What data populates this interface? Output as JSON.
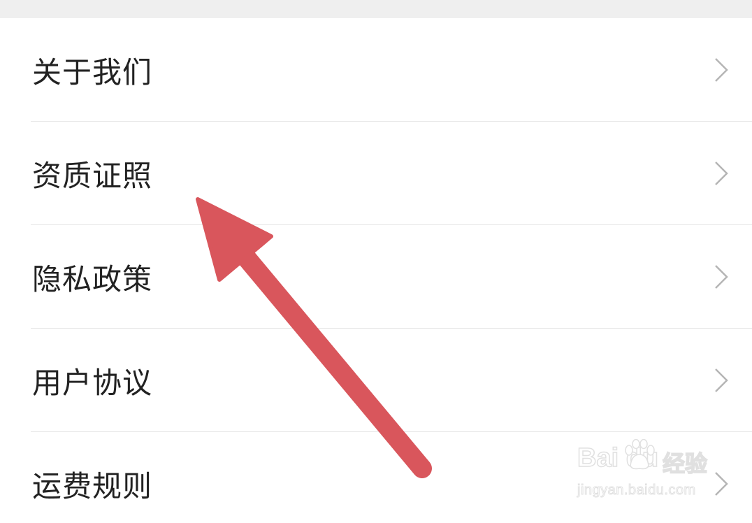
{
  "menu": {
    "items": [
      {
        "label": "关于我们",
        "chevron": "chevron-right-icon"
      },
      {
        "label": "资质证照",
        "chevron": "chevron-right-icon"
      },
      {
        "label": "隐私政策",
        "chevron": "chevron-right-icon"
      },
      {
        "label": "用户协议",
        "chevron": "chevron-right-icon"
      },
      {
        "label": "运费规则",
        "chevron": "chevron-right-icon"
      }
    ]
  },
  "annotation": {
    "arrow_color": "#d9565c",
    "points_to": "资质证照"
  },
  "watermark": {
    "brand": "Bai du",
    "product": "经验",
    "url": "jingyan.baidu.com"
  },
  "colors": {
    "background": "#ffffff",
    "top_bar": "#efefef",
    "text": "#222222",
    "divider": "#e6e6e6",
    "chevron": "#b5b5b5"
  }
}
